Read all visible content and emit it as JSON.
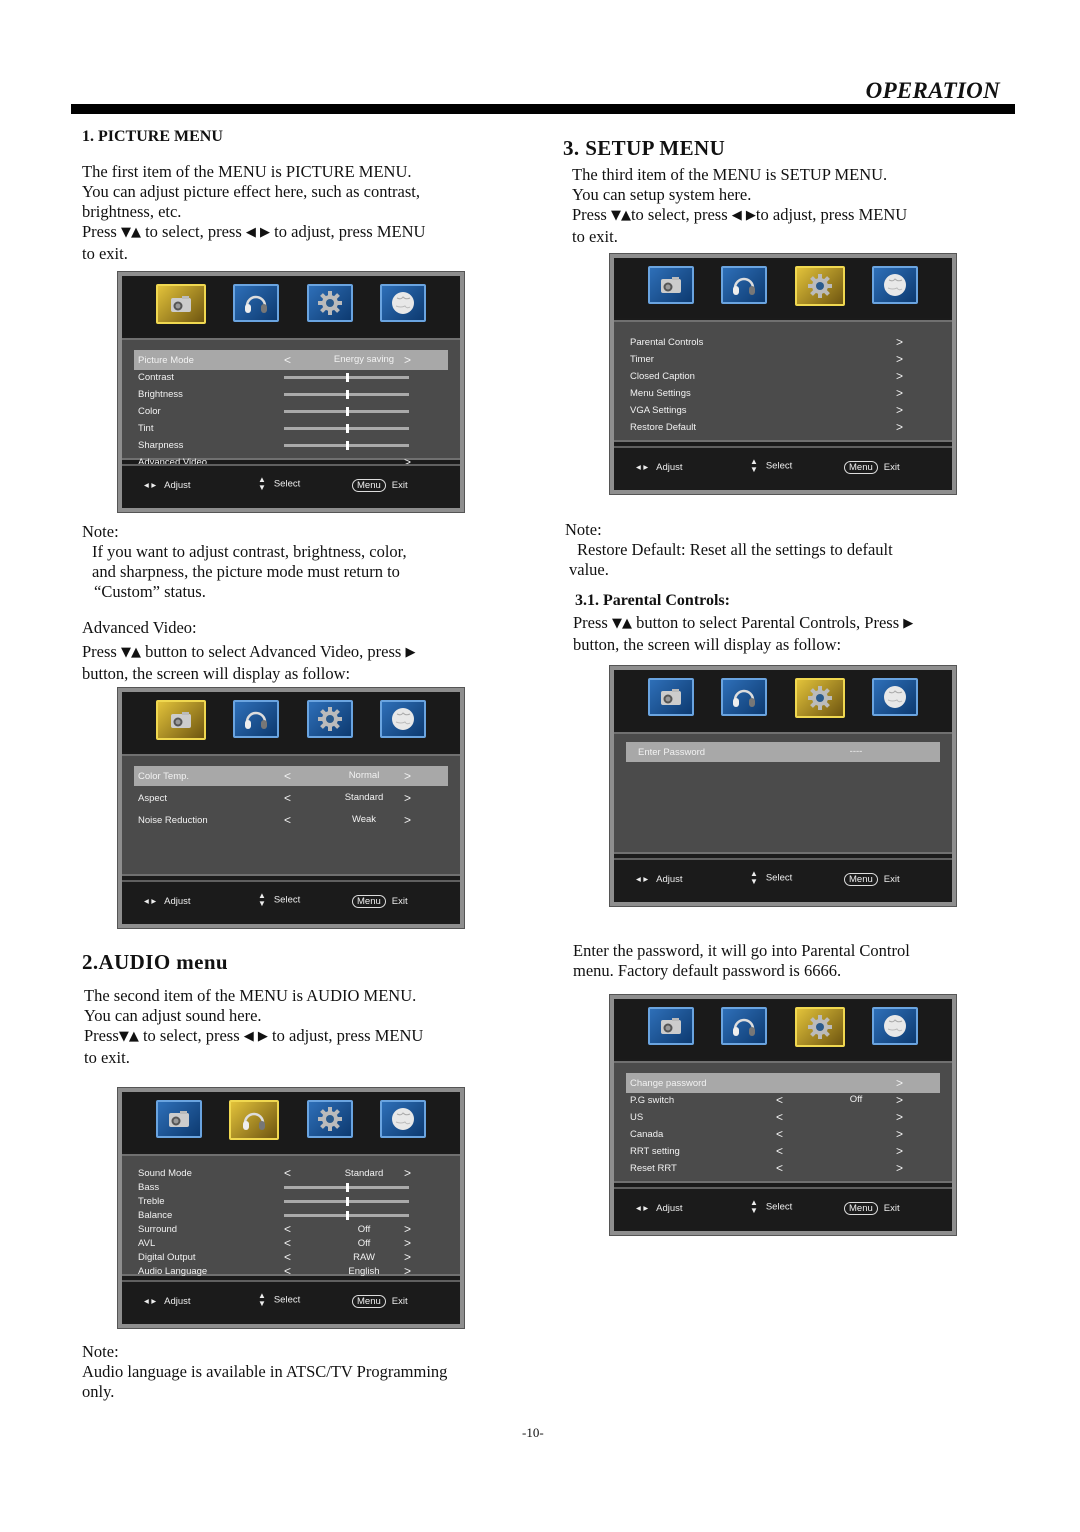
{
  "header": {
    "title": "OPERATION"
  },
  "picture": {
    "heading": "1. PICTURE MENU",
    "intro": [
      "The first item of the MENU is PICTURE MENU.",
      "You can adjust picture effect here, such as contrast,",
      "brightness, etc."
    ],
    "press": {
      "a": "Press",
      "b": "to select, press",
      "c": "to adjust, press MENU",
      "d": "to exit."
    },
    "osd": {
      "rows": [
        {
          "label": "Picture Mode",
          "value": "Energy saving",
          "selected": true
        },
        {
          "label": "Contrast",
          "slider": 0.5
        },
        {
          "label": "Brightness",
          "slider": 0.5
        },
        {
          "label": "Color",
          "slider": 0.5
        },
        {
          "label": "Tint",
          "slider": 0.5
        },
        {
          "label": "Sharpness",
          "slider": 0.5
        },
        {
          "label": "Advanced Video",
          "arrow": ">"
        }
      ]
    },
    "note_label": "Note:",
    "note": [
      "If you want to adjust contrast, brightness, color,",
      "and sharpness, the picture mode must return to",
      "“Custom” status."
    ],
    "adv_label": "Advanced Video:",
    "adv": {
      "a": "Press",
      "b": "button to select  Advanced Video, press",
      "c": "button, the screen will display as follow:"
    },
    "adv_osd": {
      "rows": [
        {
          "label": "Color Temp.",
          "value": "Normal",
          "selected": true
        },
        {
          "label": "Aspect",
          "value": "Standard"
        },
        {
          "label": "Noise Reduction",
          "value": "Weak"
        }
      ]
    }
  },
  "audio": {
    "heading": "2.AUDIO menu",
    "intro": [
      "The second item of the MENU is AUDIO MENU.",
      "You can adjust sound here."
    ],
    "press": {
      "a": "Press",
      "b": "to select, press",
      "c": "to adjust, press MENU",
      "d": "to exit."
    },
    "osd": {
      "rows": [
        {
          "label": "Sound  Mode",
          "value": "Standard"
        },
        {
          "label": "Bass",
          "slider": 0.5
        },
        {
          "label": "Treble",
          "slider": 0.5
        },
        {
          "label": "Balance",
          "slider": 0.5
        },
        {
          "label": "Surround",
          "value": "Off"
        },
        {
          "label": "AVL",
          "value": "Off"
        },
        {
          "label": "Digital Output",
          "value": "RAW"
        },
        {
          "label": "Audio Language",
          "value": "English"
        }
      ]
    },
    "note_label": "Note:",
    "note": [
      "Audio language is available in ATSC/TV Programming",
      "only."
    ]
  },
  "setup": {
    "heading": "3. SETUP  MENU",
    "intro": [
      "The third item of the MENU is SETUP MENU.",
      "You can setup system here."
    ],
    "press": {
      "a": "Press",
      "b": "to select, press",
      "c": "to adjust, press MENU",
      "d": "to exit."
    },
    "osd": {
      "rows": [
        {
          "label": "Parental Controls",
          "arrow": ">"
        },
        {
          "label": "Timer",
          "arrow": ">"
        },
        {
          "label": "Closed Caption",
          "arrow": ">"
        },
        {
          "label": "Menu Settings",
          "arrow": ">"
        },
        {
          "label": "VGA Settings",
          "arrow": ">"
        },
        {
          "label": "Restore Default",
          "arrow": ">"
        }
      ]
    },
    "note_label": "Note:",
    "note": [
      "Restore Default: Reset all the settings to default",
      "value."
    ],
    "parental_heading": "3.1. Parental Controls:",
    "parental": {
      "a": "Press",
      "b": "button to select Parental Controls, Press",
      "c": "button, the screen will display as follow:"
    },
    "pw_osd": {
      "label": "Enter Password",
      "value": "----"
    },
    "pw_text": [
      "Enter the password, it will go into Parental Control",
      "menu. Factory default password is 6666."
    ],
    "pc_osd": {
      "rows": [
        {
          "label": "Change password",
          "arrow": ">",
          "selected": true
        },
        {
          "label": "P.G switch",
          "value": "Off"
        },
        {
          "label": "US",
          "value": ""
        },
        {
          "label": "Canada",
          "value": ""
        },
        {
          "label": "RRT setting",
          "value": ""
        },
        {
          "label": "Reset  RRT",
          "value": ""
        }
      ]
    }
  },
  "osd_common": {
    "tabs": [
      "picture-icon",
      "audio-icon",
      "setup-icon",
      "globe-icon"
    ],
    "footer": {
      "adjust": "Adjust",
      "select": "Select",
      "menu": "Menu",
      "exit": "Exit"
    }
  },
  "page_number": "-10-"
}
